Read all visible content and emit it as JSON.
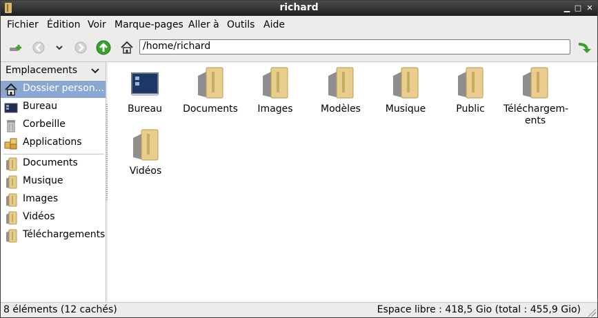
{
  "window": {
    "title": "richard"
  },
  "menu": [
    "Fichier",
    "Édition",
    "Voir",
    "Marque-pages",
    "Aller à",
    "Outils",
    "Aide"
  ],
  "toolbar": {
    "location": "/home/richard",
    "icons": [
      "new-tab-icon",
      "back-icon",
      "history-dropdown-icon",
      "forward-icon",
      "up-icon",
      "home-icon",
      "go-icon"
    ]
  },
  "sidebar": {
    "header": "Emplacements",
    "places": [
      {
        "label": "Dossier person...",
        "icon": "home-icon",
        "selected": true
      },
      {
        "label": "Bureau",
        "icon": "desktop-icon"
      },
      {
        "label": "Corbeille",
        "icon": "trash-icon"
      },
      {
        "label": "Applications",
        "icon": "applications-icon"
      }
    ],
    "bookmarks": [
      {
        "label": "Documents",
        "icon": "folder-icon"
      },
      {
        "label": "Musique",
        "icon": "folder-icon"
      },
      {
        "label": "Images",
        "icon": "folder-icon"
      },
      {
        "label": "Vidéos",
        "icon": "folder-icon"
      },
      {
        "label": "Téléchargements",
        "icon": "folder-icon"
      }
    ]
  },
  "files": [
    {
      "name": "Bureau",
      "icon": "desktop-icon"
    },
    {
      "name": "Documents",
      "icon": "folder-icon"
    },
    {
      "name": "Images",
      "icon": "folder-icon"
    },
    {
      "name": "Modèles",
      "icon": "folder-icon"
    },
    {
      "name": "Musique",
      "icon": "folder-icon"
    },
    {
      "name": "Public",
      "icon": "folder-icon"
    },
    {
      "name": "Téléchargem-\nents",
      "icon": "folder-icon"
    },
    {
      "name": "Vidéos",
      "icon": "folder-icon"
    }
  ],
  "status": {
    "left": "8 éléments (12 cachés)",
    "right": "Espace libre : 418,5 Gio (total : 455,9 Gio)"
  },
  "colors": {
    "selection": "#8aa7d1",
    "folder": "#e6cc8a",
    "up_button": "#3aa12b"
  }
}
